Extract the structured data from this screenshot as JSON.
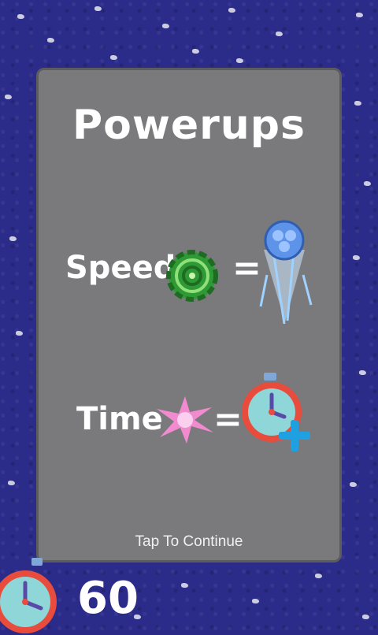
{
  "panel": {
    "title": "Powerups",
    "rows": [
      {
        "label": "Speed",
        "equals": "=",
        "item_icon": "green-swirl-orb-icon",
        "result_icon": "blue-comet-icon"
      },
      {
        "label": "Time",
        "equals": "=",
        "item_icon": "pink-splat-icon",
        "result_icon": "clock-plus-icon"
      }
    ],
    "footer": "Tap To Continue"
  },
  "hud": {
    "timer_value": "60",
    "timer_icon": "stopwatch-icon"
  },
  "colors": {
    "background": "#2b2b8a",
    "panel": "#7a7a7c",
    "text": "#ffffff"
  }
}
